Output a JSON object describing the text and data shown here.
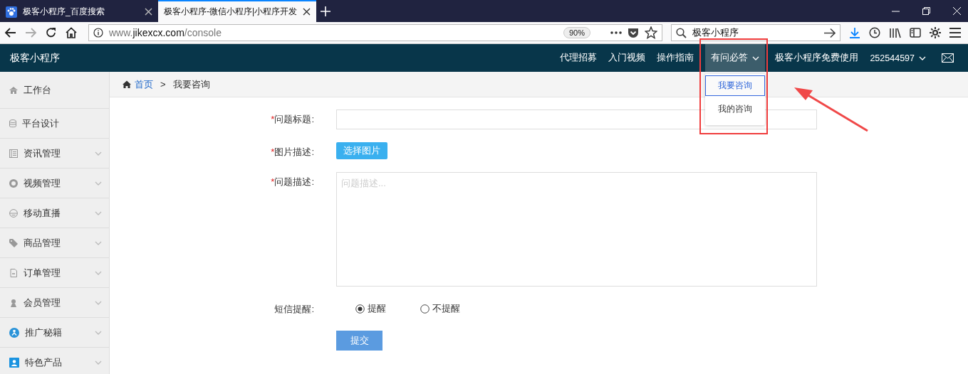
{
  "browser": {
    "tabs": [
      {
        "title": "极客小程序_百度搜索",
        "selected": false
      },
      {
        "title": "极客小程序-微信小程序|小程序开发",
        "selected": true
      }
    ],
    "address": {
      "prefix": "www.",
      "domain": "jikexcx.com",
      "path": "/console"
    },
    "zoom": "90%",
    "search": {
      "value": "极客小程序"
    }
  },
  "header": {
    "brand": "极客小程序",
    "nav": [
      {
        "label": "代理招募",
        "selected": false,
        "dropdown": false
      },
      {
        "label": "入门视频",
        "selected": false,
        "dropdown": false
      },
      {
        "label": "操作指南",
        "selected": false,
        "dropdown": false
      },
      {
        "label": "有问必答",
        "selected": true,
        "dropdown": true
      },
      {
        "label": "极客小程序免费使用",
        "selected": false,
        "dropdown": false
      },
      {
        "label": "252544597",
        "selected": false,
        "dropdown": true
      }
    ],
    "menu": [
      {
        "label": "我要咨询",
        "selected": true
      },
      {
        "label": "我的咨询",
        "selected": false
      }
    ]
  },
  "sidebar": {
    "items": [
      {
        "label": "工作台",
        "expandable": false
      },
      {
        "label": "平台设计",
        "expandable": false
      },
      {
        "label": "资讯管理",
        "expandable": true
      },
      {
        "label": "视频管理",
        "expandable": true
      },
      {
        "label": "移动直播",
        "expandable": true
      },
      {
        "label": "商品管理",
        "expandable": true
      },
      {
        "label": "订单管理",
        "expandable": true
      },
      {
        "label": "会员管理",
        "expandable": true
      },
      {
        "label": "推广秘籍",
        "expandable": true
      },
      {
        "label": "特色产品",
        "expandable": true
      }
    ]
  },
  "breadcrumb": {
    "home": "首页",
    "separator": ">",
    "current": "我要咨询"
  },
  "form": {
    "fields": [
      {
        "kind": "text",
        "mark": "*",
        "label": "问题标题:"
      },
      {
        "kind": "image",
        "mark": "*",
        "label": "图片描述:",
        "button": "选择图片"
      },
      {
        "kind": "textarea",
        "mark": "*",
        "label": "问题描述:",
        "placeholder": "问题描述..."
      },
      {
        "kind": "radio",
        "label": "短信提醒:",
        "options": [
          {
            "label": "提醒",
            "selected": true
          },
          {
            "label": "不提醒",
            "selected": false
          }
        ]
      }
    ],
    "submit": "提交"
  }
}
